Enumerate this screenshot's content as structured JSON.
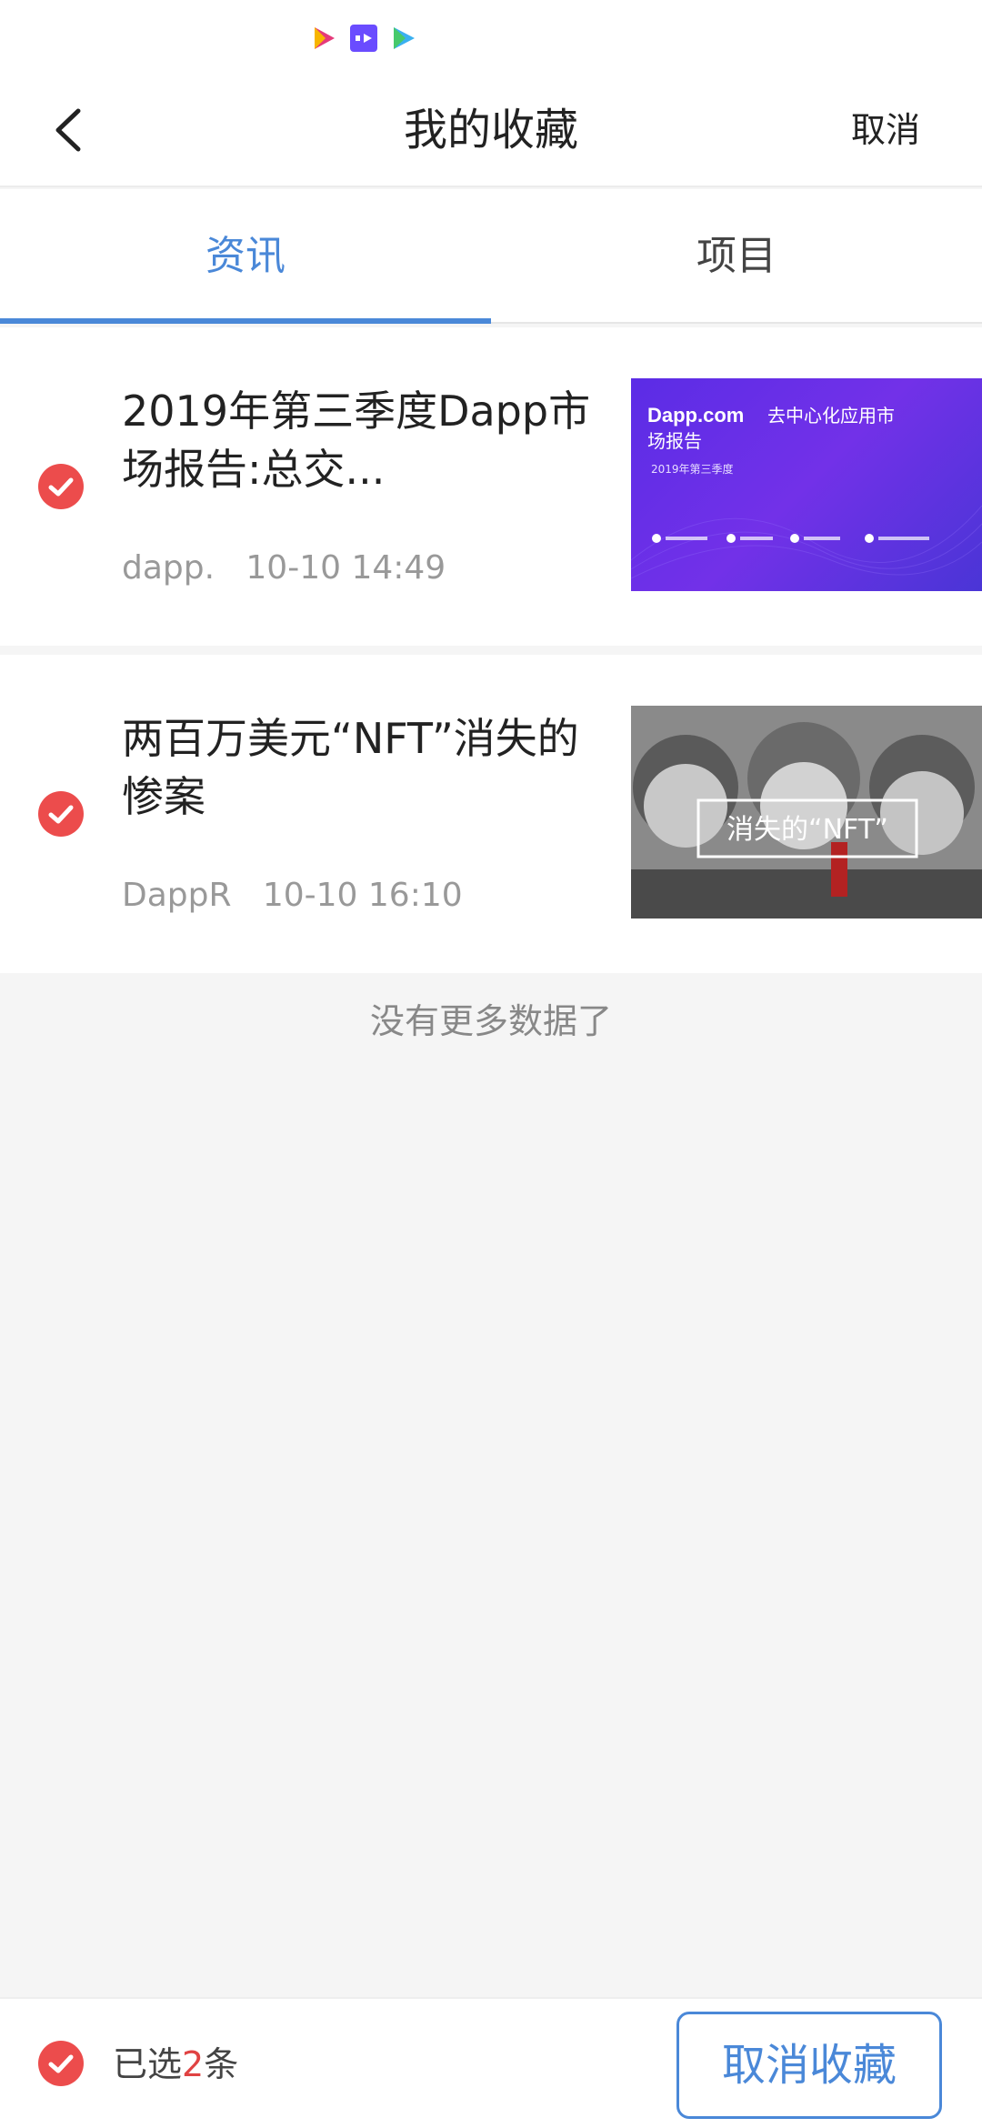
{
  "status_bar": {
    "icons": [
      "video-play-icon",
      "media-app-icon",
      "video-app-icon"
    ]
  },
  "header": {
    "title": "我的收藏",
    "cancel_label": "取消"
  },
  "tabs": [
    {
      "label": "资讯",
      "active": true
    },
    {
      "label": "项目",
      "active": false
    }
  ],
  "items": [
    {
      "title": "2019年第三季度Dapp市场报告:总交...",
      "source": "dapp.",
      "time": "10-10 14:49",
      "checked": true,
      "thumbnail": {
        "brand": "Dapp.com",
        "heading_line1": "去中心化应用市",
        "heading_line2": "场报告",
        "subtitle": "2019年第三季度"
      }
    },
    {
      "title": "两百万美元“NFT”消失的惨案",
      "source": "DappR",
      "time": "10-10 16:10",
      "checked": true,
      "thumbnail": {
        "overlay": "消失的“NFT”"
      }
    }
  ],
  "no_more_text": "没有更多数据了",
  "footer": {
    "selected_prefix": "已选",
    "selected_count": "2",
    "selected_suffix": "条",
    "unfavorite_label": "取消收藏"
  },
  "colors": {
    "accent": "#4a88d8",
    "check": "#ec4c4c",
    "count_red": "#e04343"
  }
}
